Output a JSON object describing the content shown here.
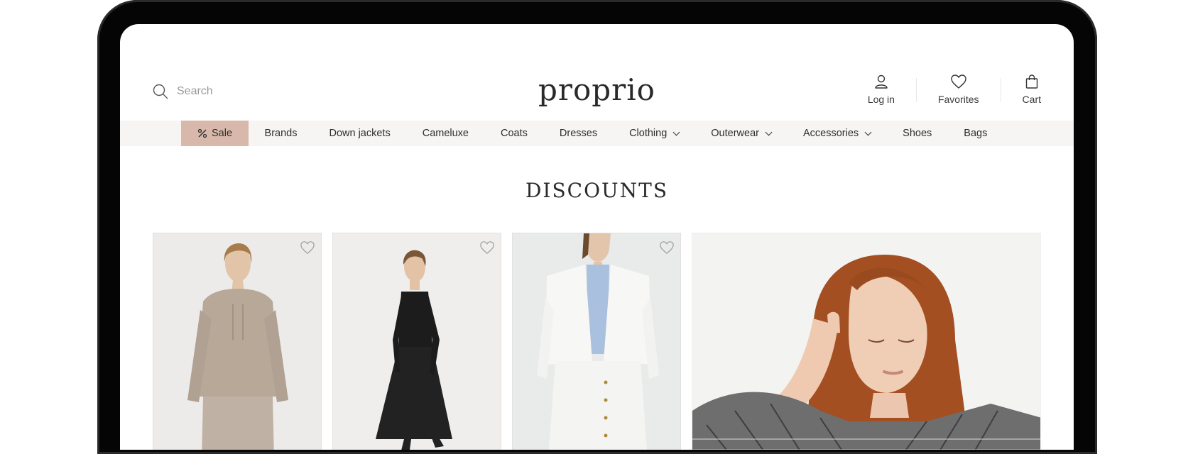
{
  "header": {
    "search_placeholder": "Search",
    "logo": "proprio",
    "actions": [
      {
        "label": "Log in",
        "icon": "user-icon"
      },
      {
        "label": "Favorites",
        "icon": "heart-icon"
      },
      {
        "label": "Cart",
        "icon": "shopping-bag-icon"
      }
    ]
  },
  "nav": {
    "items": [
      {
        "label": "Sale",
        "icon": "percent-icon",
        "highlight": true
      },
      {
        "label": "Brands"
      },
      {
        "label": "Down jackets"
      },
      {
        "label": "Cameluxe"
      },
      {
        "label": "Coats"
      },
      {
        "label": "Dresses"
      },
      {
        "label": "Clothing",
        "dropdown": true
      },
      {
        "label": "Outerwear",
        "dropdown": true
      },
      {
        "label": "Accessories",
        "dropdown": true
      },
      {
        "label": "Shoes"
      },
      {
        "label": "Bags"
      }
    ]
  },
  "page": {
    "title": "DISCOUNTS"
  },
  "products": [
    {
      "image": "beige knit hoodie set",
      "favorite_icon": "heart-icon"
    },
    {
      "image": "black lace midi dress",
      "favorite_icon": "heart-icon"
    },
    {
      "image": "white cropped jacket with blue shirt",
      "favorite_icon": "heart-icon"
    },
    {
      "image": "red-haired model in tweed jacket"
    }
  ],
  "colors": {
    "sale_bg": "#d7b8aa",
    "nav_bg": "#f6f5f3",
    "text": "#2b2b2b"
  }
}
